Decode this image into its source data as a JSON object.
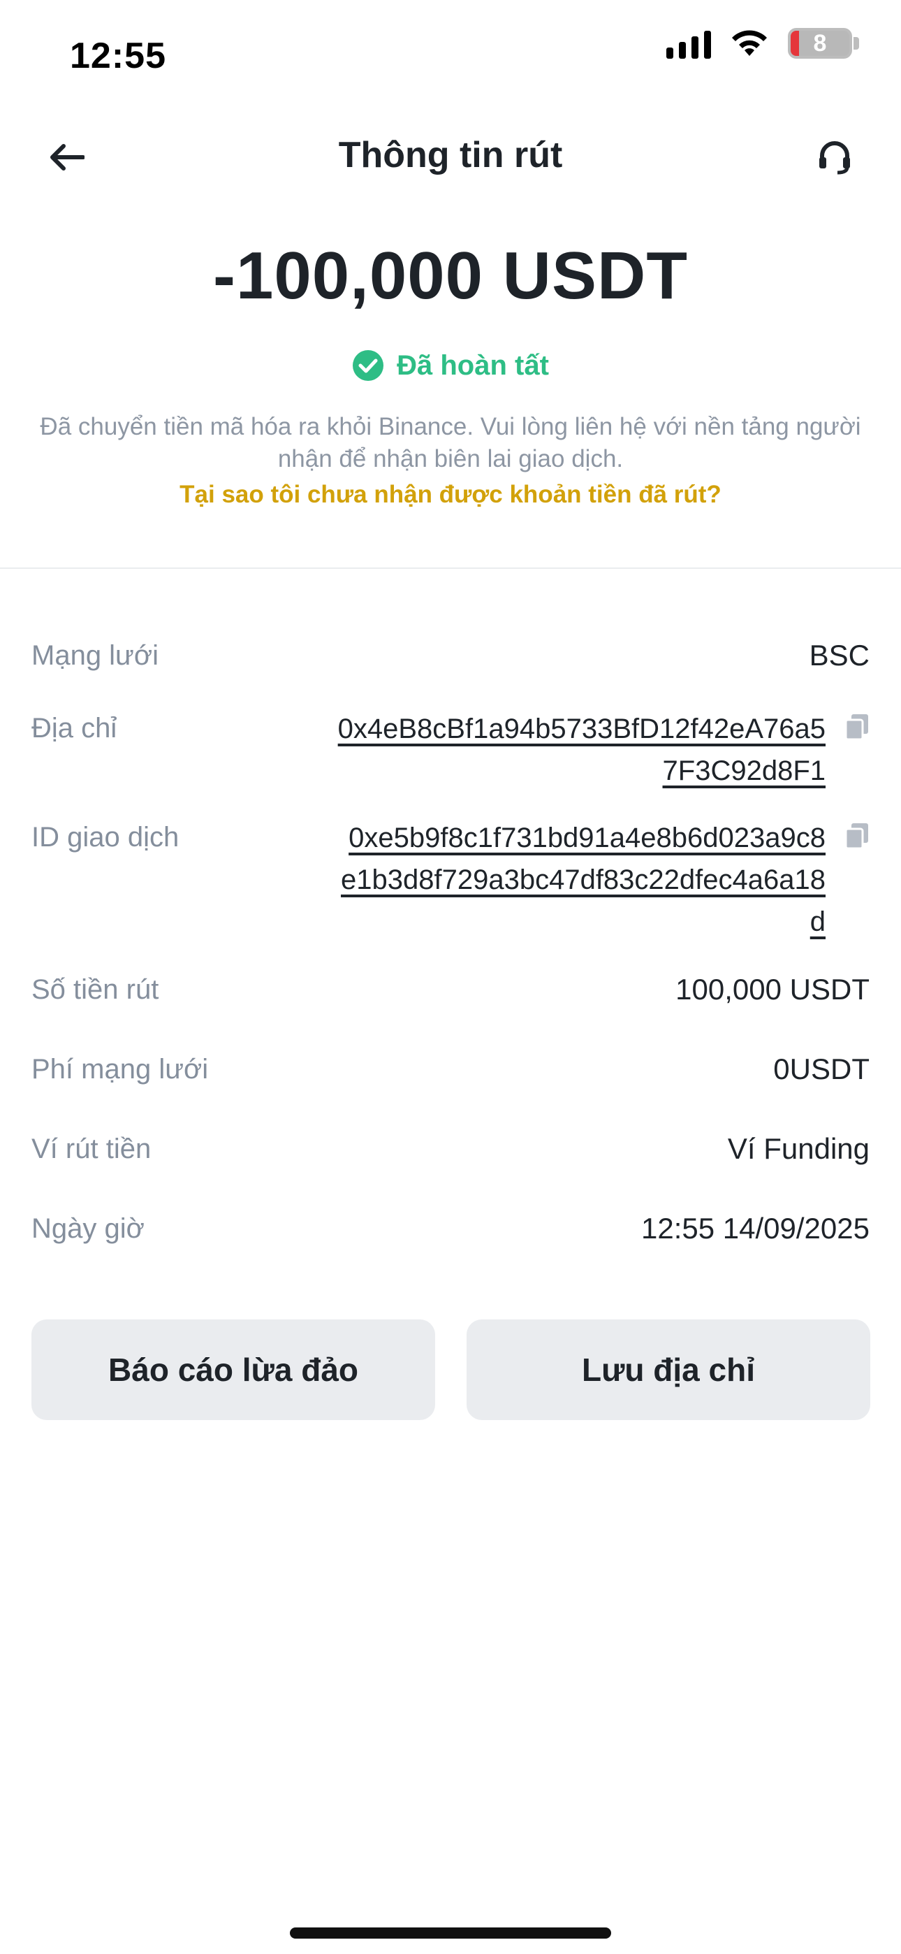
{
  "status_bar": {
    "time": "12:55",
    "battery_level": "8",
    "icons": [
      "signal-icon",
      "wifi-icon",
      "battery-icon"
    ]
  },
  "header": {
    "title": "Thông tin rút",
    "back_icon": "arrow-left-icon",
    "support_icon": "headset-icon"
  },
  "summary": {
    "amount": "-100,000 USDT",
    "status": "Đã hoàn tất",
    "status_icon": "check-circle-icon",
    "description": "Đã chuyển tiền mã hóa ra khỏi Binance. Vui lòng liên hệ với nền tảng người nhận để nhận biên lai giao dịch.",
    "help_link": "Tại sao tôi chưa nhận được khoản tiền đã rút?"
  },
  "details": {
    "network": {
      "label": "Mạng lưới",
      "value": "BSC"
    },
    "address": {
      "label": "Địa chỉ",
      "value": "0x4eB8cBf1a94b5733BfD12f42eA76a57F3C92d8F1"
    },
    "txid": {
      "label": "ID giao dịch",
      "value": "0xe5b9f8c1f731bd91a4e8b6d023a9c8e1b3d8f729a3bc47df83c22dfec4a6a18d"
    },
    "amount": {
      "label": "Số tiền rút",
      "value": "100,000 USDT"
    },
    "fee": {
      "label": "Phí mạng lưới",
      "value": "0USDT"
    },
    "wallet": {
      "label": "Ví rút tiền",
      "value": "Ví Funding"
    },
    "datetime": {
      "label": "Ngày giờ",
      "value": "12:55 14/09/2025"
    }
  },
  "actions": {
    "report": "Báo cáo lừa đảo",
    "save_address": "Lưu địa chỉ"
  },
  "colors": {
    "success": "#2ebd85",
    "link": "#d2a10a",
    "label": "#848e9c",
    "button_bg": "#eaecef",
    "battery_low": "#e5363b"
  }
}
